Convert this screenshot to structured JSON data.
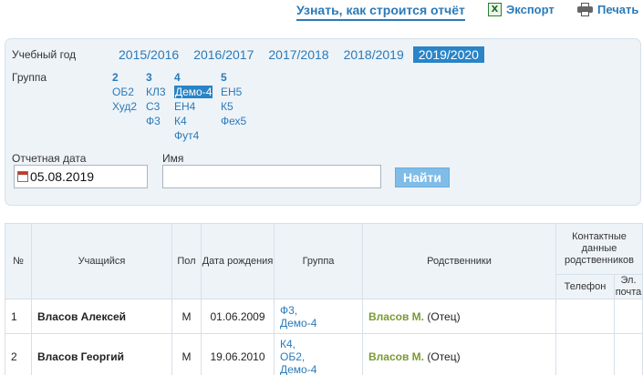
{
  "toolbar": {
    "how_label": "Узнать, как строится отчёт",
    "export_label": "Экспорт",
    "export_icon": "excel-icon",
    "print_label": "Печать",
    "print_icon": "printer-icon"
  },
  "filters": {
    "year_label": "Учебный год",
    "years": [
      "2015/2016",
      "2016/2017",
      "2017/2018",
      "2018/2019",
      "2019/2020"
    ],
    "active_year": "2019/2020",
    "group_label": "Группа",
    "grades": [
      {
        "grade": "2",
        "groups": [
          "ОБ2",
          "Худ2"
        ]
      },
      {
        "grade": "3",
        "groups": [
          "КЛ3",
          "С3",
          "Ф3"
        ]
      },
      {
        "grade": "4",
        "groups": [
          "Демо-4",
          "ЕН4",
          "К4",
          "Фут4"
        ]
      },
      {
        "grade": "5",
        "groups": [
          "ЕН5",
          "К5",
          "Фех5"
        ]
      }
    ],
    "active_group": "Демо-4",
    "date_label": "Отчетная дата",
    "date_value": "05.08.2019",
    "name_label": "Имя",
    "name_value": "",
    "find_label": "Найти"
  },
  "table": {
    "headers": {
      "num": "№",
      "student": "Учащийся",
      "sex": "Пол",
      "birth": "Дата рождения",
      "group": "Группа",
      "relatives": "Родственники",
      "contacts": "Контактные данные родственников",
      "phone": "Телефон",
      "email": "Эл. почта"
    },
    "rows": [
      {
        "num": "1",
        "student": "Власов Алексей",
        "sex": "М",
        "birth": "01.06.2009",
        "groups": [
          "Ф3,",
          "Демо-4"
        ],
        "relative_name": "Власов М.",
        "relative_role": "(Отец)",
        "phone": "",
        "email": ""
      },
      {
        "num": "2",
        "student": "Власов Георгий",
        "sex": "М",
        "birth": "19.06.2010",
        "groups": [
          "К4,",
          "ОБ2,",
          "Демо-4"
        ],
        "relative_name": "Власов М.",
        "relative_role": "(Отец)",
        "phone": "",
        "email": ""
      }
    ]
  }
}
